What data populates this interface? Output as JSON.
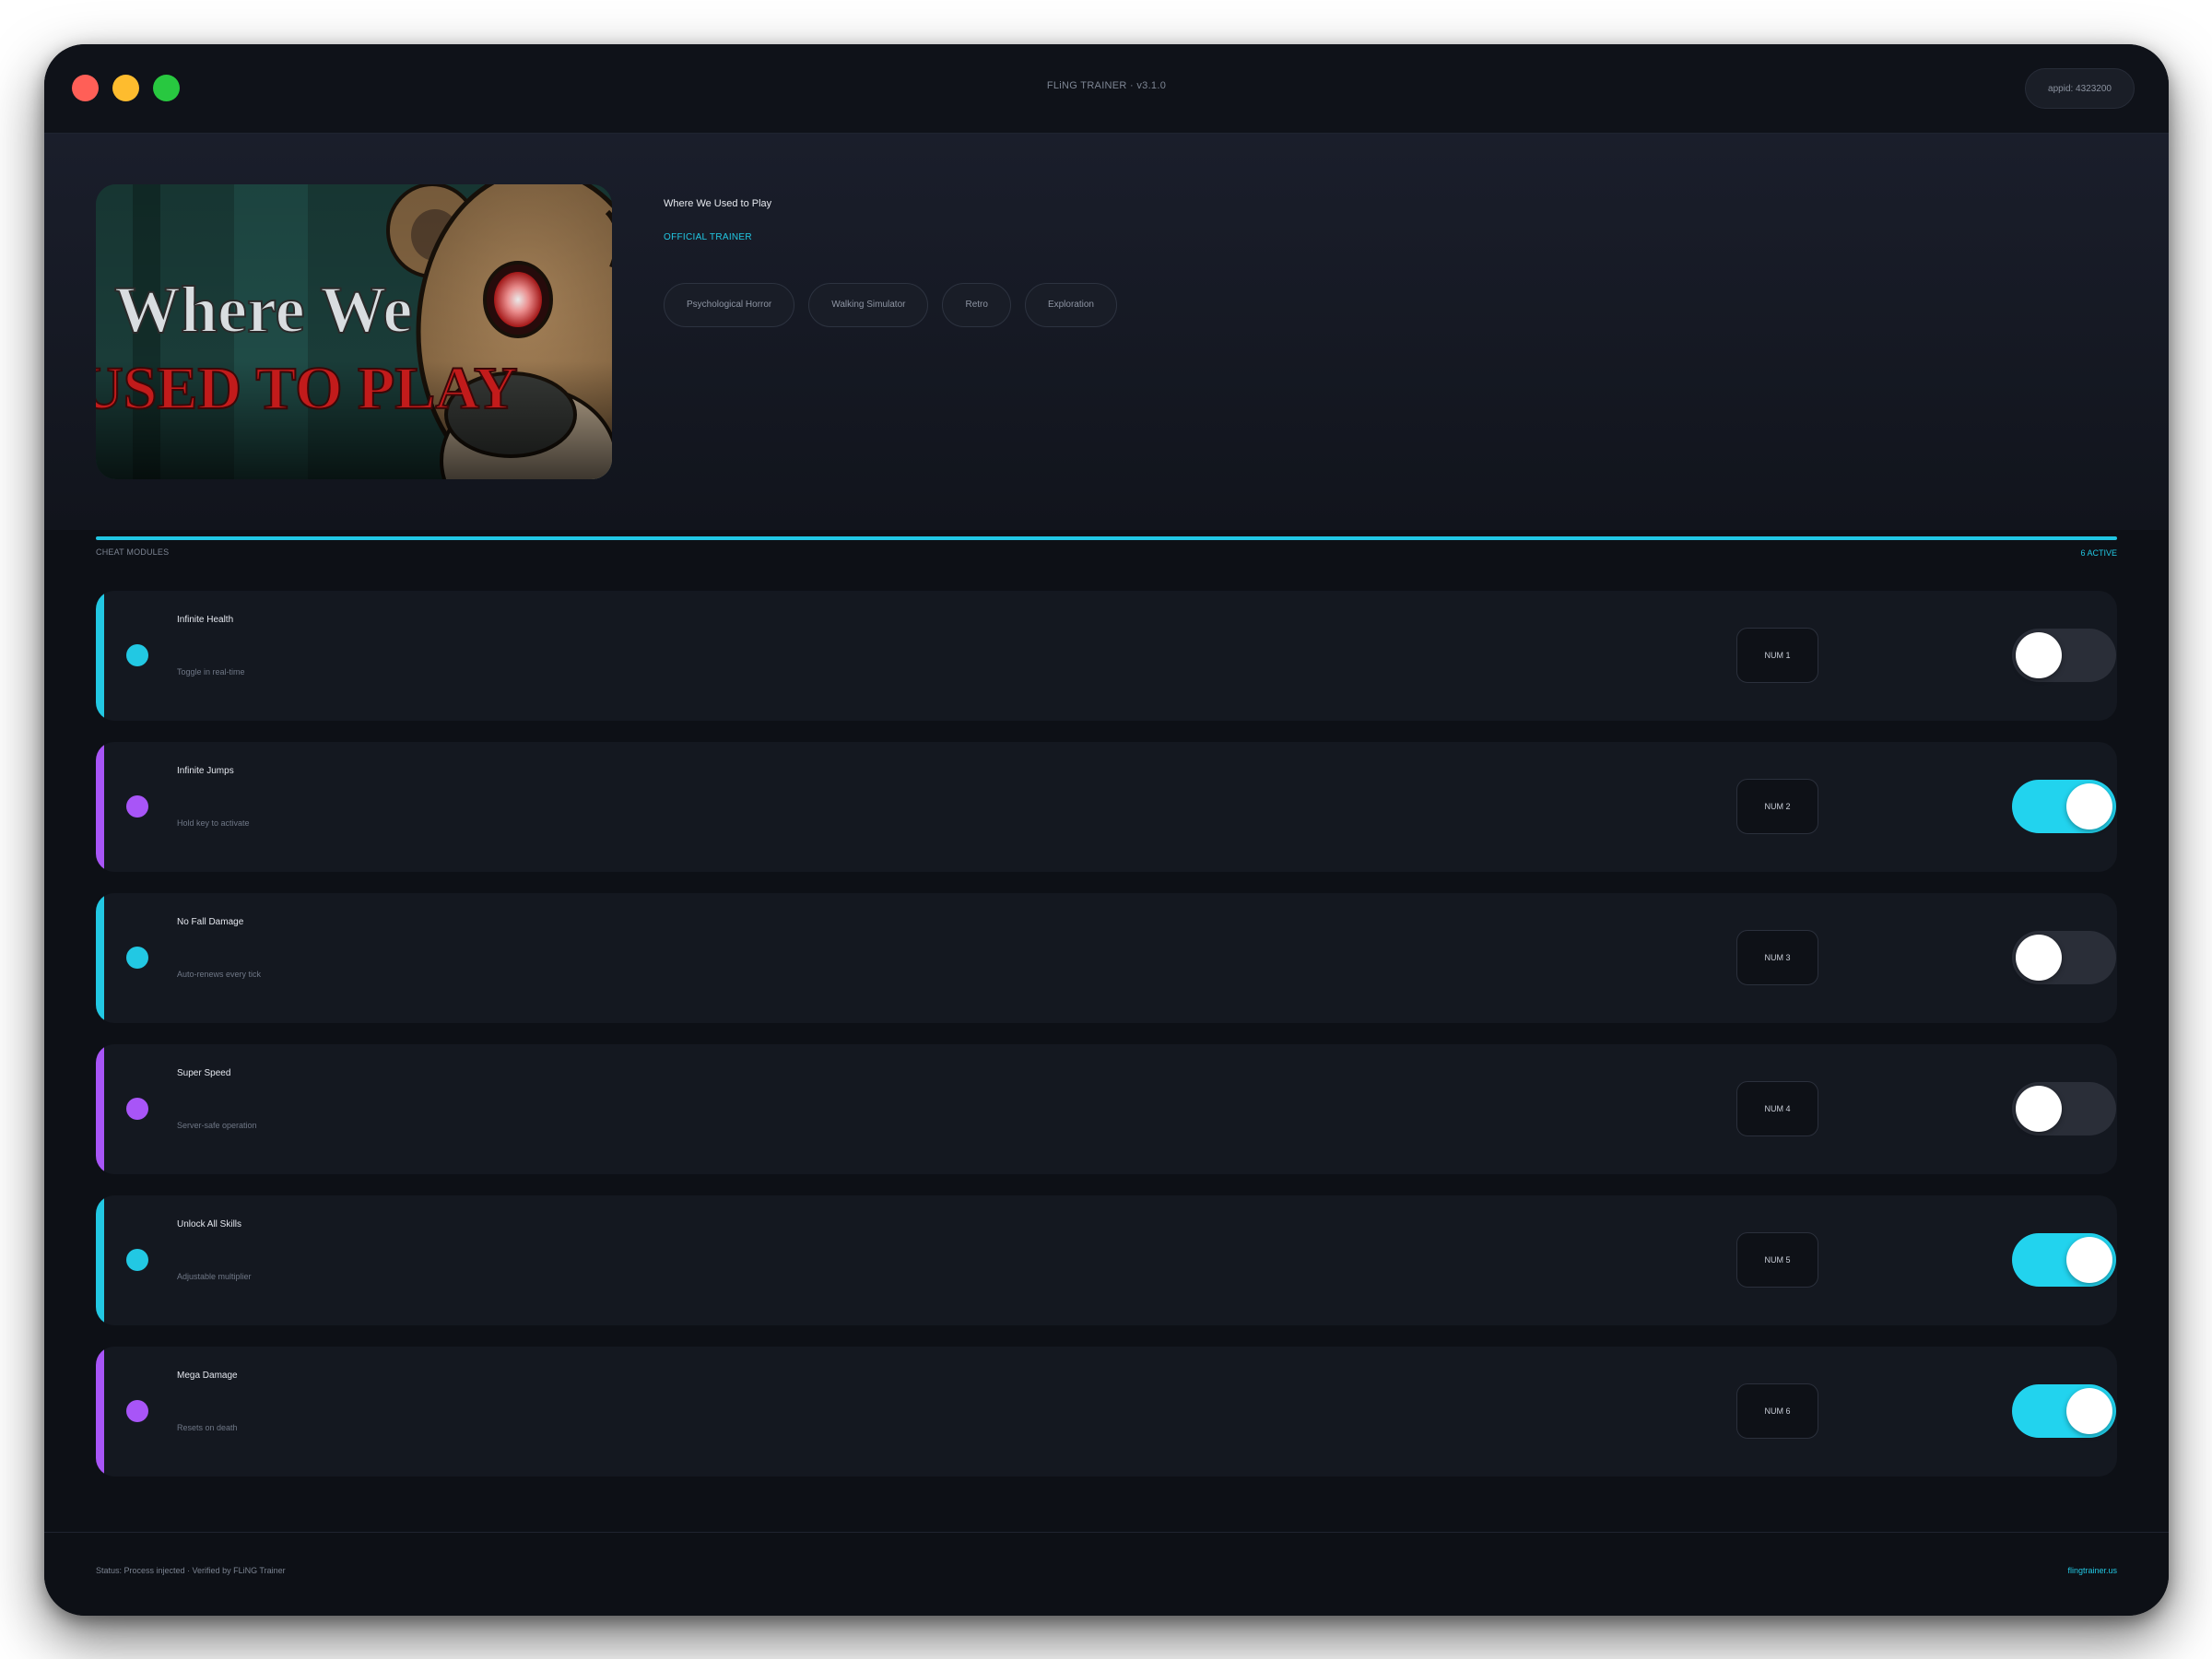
{
  "window": {
    "title": "FLiNG TRAINER · v3.1.0",
    "appid_label": "appid: 4323200"
  },
  "game": {
    "title": "Where We Used to Play",
    "official_label": "OFFICIAL TRAINER",
    "cover_art_text_line1": "Where We",
    "cover_art_text_line2": "USED TO PLAY",
    "tags": [
      "Psychological Horror",
      "Walking Simulator",
      "Retro",
      "Exploration"
    ]
  },
  "section": {
    "label": "CHEAT MODULES",
    "count_label": "6 ACTIVE"
  },
  "modules": [
    {
      "name": "Infinite Health",
      "desc": "Toggle in real-time",
      "hotkey": "NUM 1",
      "enabled": false,
      "accent": "#22c8e3"
    },
    {
      "name": "Infinite Jumps",
      "desc": "Hold key to activate",
      "hotkey": "NUM 2",
      "enabled": true,
      "accent": "#a855f7"
    },
    {
      "name": "No Fall Damage",
      "desc": "Auto-renews every tick",
      "hotkey": "NUM 3",
      "enabled": false,
      "accent": "#22c8e3"
    },
    {
      "name": "Super Speed",
      "desc": "Server-safe operation",
      "hotkey": "NUM 4",
      "enabled": false,
      "accent": "#a855f7"
    },
    {
      "name": "Unlock All Skills",
      "desc": "Adjustable multiplier",
      "hotkey": "NUM 5",
      "enabled": true,
      "accent": "#22c8e3"
    },
    {
      "name": "Mega Damage",
      "desc": "Resets on death",
      "hotkey": "NUM 6",
      "enabled": true,
      "accent": "#a855f7"
    }
  ],
  "footer": {
    "status": "Status: Process injected · Verified by FLiNG Trainer",
    "link": "flingtrainer.us"
  },
  "colors": {
    "accent_cyan": "#22c8e3",
    "accent_purple": "#a855f7",
    "toggle_on": "#22d3ee",
    "toggle_off": "#2a2e38"
  }
}
